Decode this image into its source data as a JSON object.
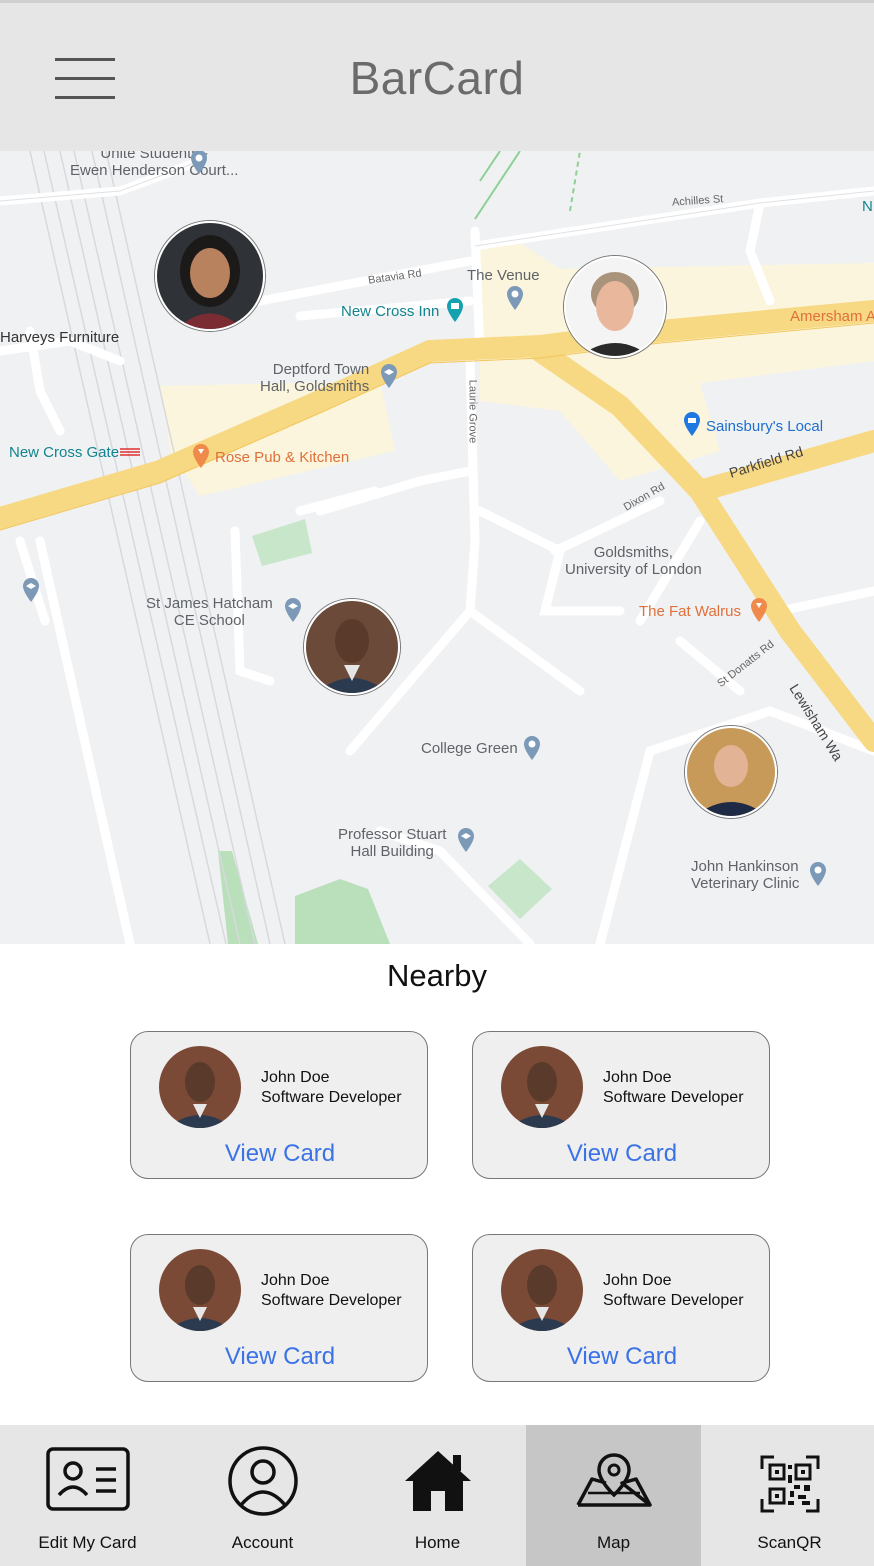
{
  "app": {
    "title": "BarCard"
  },
  "map": {
    "labels": {
      "unite_students": "Unite Students -\nEwen Henderson Court...",
      "achilles": "Achilles St",
      "batavia": "Batavia Rd",
      "venue": "The Venue",
      "harveys": "Harveys Furniture",
      "new_cross_inn": "New Cross Inn",
      "amersham": "Amersham A",
      "deptford": "Deptford Town\nHall, Goldsmiths",
      "laurie": "Laurie Grove",
      "sainsburys": "Sainsbury's Local",
      "new_cross_gate": "New Cross Gate",
      "rose_pub": "Rose Pub & Kitchen",
      "parkfield": "Parkfield Rd",
      "dixon": "Dixon Rd",
      "goldsmiths": "Goldsmiths,\nUniversity of London",
      "fat_walrus": "The Fat Walrus",
      "st_james": "St James Hatcham\nCE School",
      "st_donatts": "St Donatts Rd",
      "lewisham": "Lewisham Wa",
      "college_green": "College Green",
      "prof_stuart": "Professor Stuart\nHall Building",
      "john_hankinson": "John Hankinson\nVeterinary Clinic",
      "edge_n": "N"
    }
  },
  "nearby": {
    "title": "Nearby",
    "cards": [
      {
        "name": "John Doe",
        "role": "Software Developer",
        "action": "View Card"
      },
      {
        "name": "John Doe",
        "role": "Software Developer",
        "action": "View Card"
      },
      {
        "name": "John Doe",
        "role": "Software Developer",
        "action": "View Card"
      },
      {
        "name": "John Doe",
        "role": "Software Developer",
        "action": "View Card"
      }
    ]
  },
  "tabs": [
    {
      "label": "Edit My Card",
      "icon": "id-card-icon"
    },
    {
      "label": "Account",
      "icon": "user-icon"
    },
    {
      "label": "Home",
      "icon": "home-icon"
    },
    {
      "label": "Map",
      "icon": "map-pin-icon",
      "active": true
    },
    {
      "label": "ScanQR",
      "icon": "qr-code-icon"
    }
  ],
  "colors": {
    "header_bg": "#e6e6e6",
    "accent_link": "#3b72e6",
    "active_tab": "#c6c6c6",
    "major_road": "#f7d883"
  }
}
